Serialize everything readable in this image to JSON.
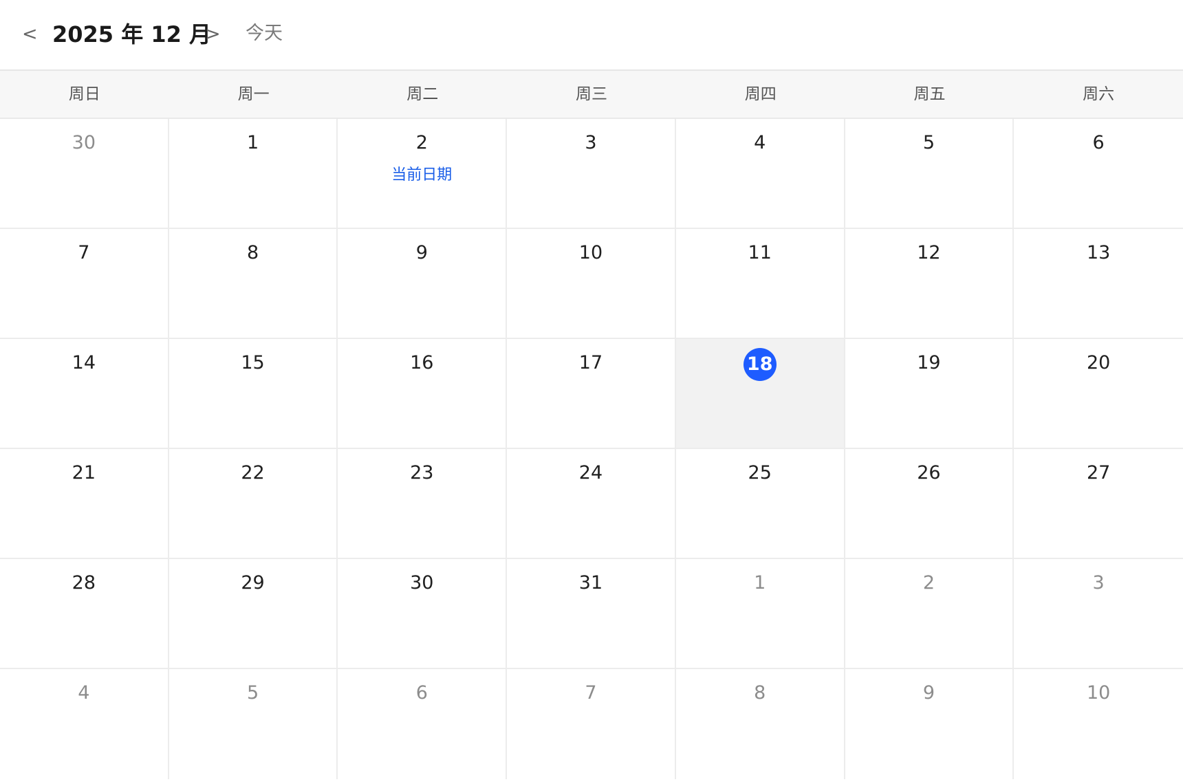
{
  "header": {
    "prev_label": "<",
    "title": "2025 年 12 月",
    "next_label": ">",
    "today_label": "今天"
  },
  "weekdays": [
    "周日",
    "周一",
    "周二",
    "周三",
    "周四",
    "周五",
    "周六"
  ],
  "weeks": [
    [
      {
        "day": "30",
        "other_month": true
      },
      {
        "day": "1"
      },
      {
        "day": "2",
        "label": "当前日期"
      },
      {
        "day": "3"
      },
      {
        "day": "4"
      },
      {
        "day": "5"
      },
      {
        "day": "6"
      }
    ],
    [
      {
        "day": "7"
      },
      {
        "day": "8"
      },
      {
        "day": "9"
      },
      {
        "day": "10"
      },
      {
        "day": "11"
      },
      {
        "day": "12"
      },
      {
        "day": "13"
      }
    ],
    [
      {
        "day": "14"
      },
      {
        "day": "15"
      },
      {
        "day": "16"
      },
      {
        "day": "17"
      },
      {
        "day": "18",
        "selected": true
      },
      {
        "day": "19"
      },
      {
        "day": "20"
      }
    ],
    [
      {
        "day": "21"
      },
      {
        "day": "22"
      },
      {
        "day": "23"
      },
      {
        "day": "24"
      },
      {
        "day": "25"
      },
      {
        "day": "26"
      },
      {
        "day": "27"
      }
    ],
    [
      {
        "day": "28"
      },
      {
        "day": "29"
      },
      {
        "day": "30"
      },
      {
        "day": "31"
      },
      {
        "day": "1",
        "other_month": true
      },
      {
        "day": "2",
        "other_month": true
      },
      {
        "day": "3",
        "other_month": true
      }
    ],
    [
      {
        "day": "4",
        "other_month": true
      },
      {
        "day": "5",
        "other_month": true
      },
      {
        "day": "6",
        "other_month": true
      },
      {
        "day": "7",
        "other_month": true
      },
      {
        "day": "8",
        "other_month": true
      },
      {
        "day": "9",
        "other_month": true
      },
      {
        "day": "10",
        "other_month": true
      }
    ]
  ],
  "colors": {
    "accent": "#1e5cff",
    "label": "#1a5ee8",
    "selected_bg": "#f2f2f2",
    "other_month_text": "#8c8c8c"
  }
}
